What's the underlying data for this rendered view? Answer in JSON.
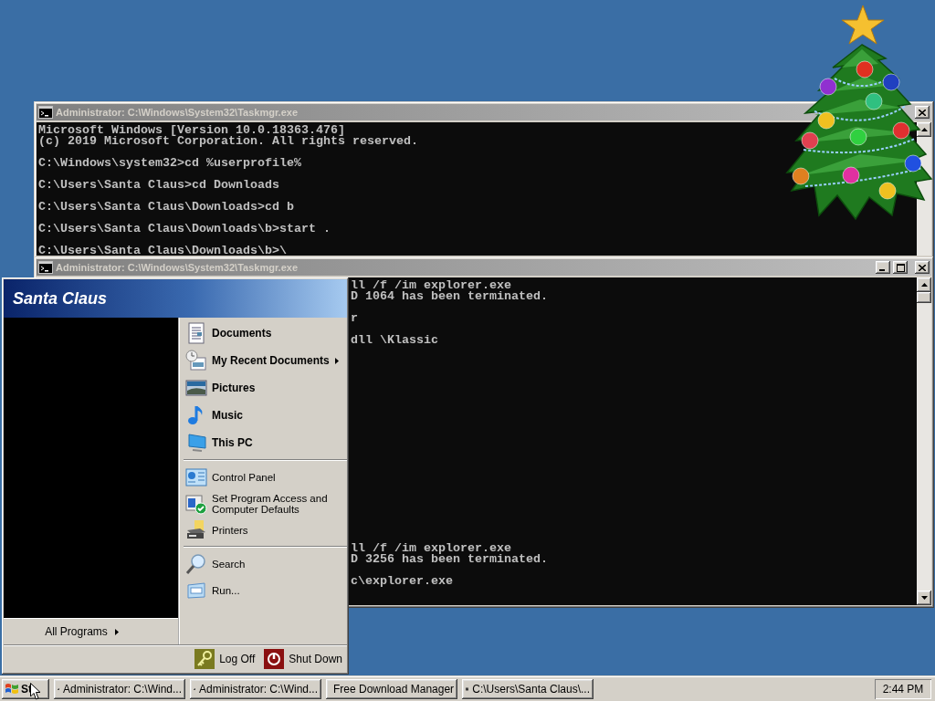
{
  "windows": [
    {
      "title": "Administrator: C:\\Windows\\System32\\Taskmgr.exe",
      "active": false,
      "lines": [
        {
          "kind": "text",
          "text": "Microsoft Windows [Version 10.0.18363.476]"
        },
        {
          "kind": "text",
          "text": "(c) 2019 Microsoft Corporation. All rights reserved."
        },
        {
          "kind": "blank"
        },
        {
          "kind": "text",
          "text": "C:\\Windows\\system32>cd %userprofile%"
        },
        {
          "kind": "blank"
        },
        {
          "kind": "text",
          "text": "C:\\Users\\Santa Claus>cd Downloads"
        },
        {
          "kind": "blank"
        },
        {
          "kind": "text",
          "text": "C:\\Users\\Santa Claus\\Downloads>cd b"
        },
        {
          "kind": "blank"
        },
        {
          "kind": "text",
          "text": "C:\\Users\\Santa Claus\\Downloads\\b>start ."
        },
        {
          "kind": "blank"
        },
        {
          "kind": "text",
          "text": "C:\\Users\\Santa Claus\\Downloads\\b>\\"
        }
      ]
    },
    {
      "title": "Administrator: C:\\Windows\\System32\\Taskmgr.exe",
      "active": false,
      "lines": [
        {
          "kind": "text",
          "text": "ll /f /im explorer.exe"
        },
        {
          "kind": "text",
          "text": "D 1064 has been terminated."
        },
        {
          "kind": "blank"
        },
        {
          "kind": "text",
          "text": "r"
        },
        {
          "kind": "blank"
        },
        {
          "kind": "text",
          "text": "dll \\Klassic"
        },
        {
          "kind": "blank"
        },
        {
          "kind": "blank"
        },
        {
          "kind": "blank"
        },
        {
          "kind": "blank"
        },
        {
          "kind": "blank"
        },
        {
          "kind": "blank"
        },
        {
          "kind": "blank"
        },
        {
          "kind": "blank"
        },
        {
          "kind": "blank"
        },
        {
          "kind": "blank"
        },
        {
          "kind": "blank"
        },
        {
          "kind": "blank"
        },
        {
          "kind": "blank"
        },
        {
          "kind": "blank"
        },
        {
          "kind": "blank"
        },
        {
          "kind": "blank"
        },
        {
          "kind": "blank"
        },
        {
          "kind": "blank"
        },
        {
          "kind": "text",
          "text": "ll /f /im explorer.exe"
        },
        {
          "kind": "text",
          "text": "D 3256 has been terminated."
        },
        {
          "kind": "blank"
        },
        {
          "kind": "text",
          "text": "c\\explorer.exe"
        }
      ]
    }
  ],
  "start_menu": {
    "user": "Santa Claus",
    "all_programs": "All Programs",
    "groups": [
      {
        "bold": true,
        "items": [
          {
            "label": "Documents",
            "submenu": false
          },
          {
            "label": "My Recent Documents",
            "submenu": true
          },
          {
            "label": "Pictures",
            "submenu": false
          },
          {
            "label": "Music",
            "submenu": false
          },
          {
            "label": "This PC",
            "submenu": false
          }
        ]
      },
      {
        "bold": false,
        "items": [
          {
            "label": "Control Panel",
            "submenu": false
          },
          {
            "label": "Set Program Access and Computer Defaults",
            "submenu": false
          },
          {
            "label": "Printers",
            "submenu": false
          }
        ]
      },
      {
        "bold": false,
        "items": [
          {
            "label": "Search",
            "submenu": false
          },
          {
            "label": "Run...",
            "submenu": false
          }
        ]
      }
    ],
    "log_off": "Log Off",
    "shut_down": "Shut Down"
  },
  "taskbar": {
    "start": "St",
    "buttons": [
      {
        "label": "Administrator: C:\\Wind..."
      },
      {
        "label": "Administrator: C:\\Wind..."
      },
      {
        "label": "Free Download Manager"
      },
      {
        "label": "C:\\Users\\Santa Claus\\..."
      }
    ],
    "clock": "2:44 PM"
  }
}
